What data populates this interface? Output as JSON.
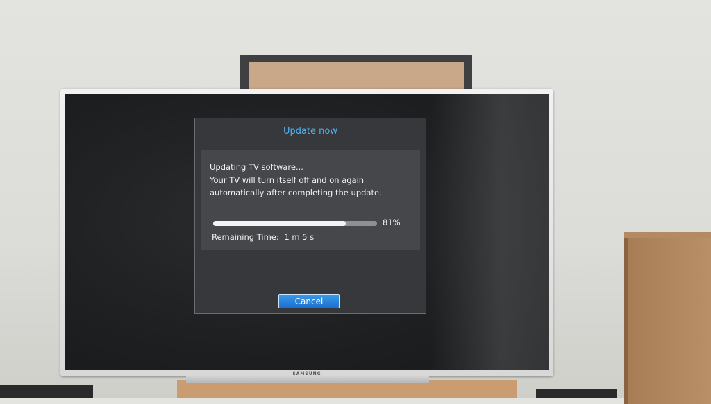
{
  "dialog": {
    "title": "Update now",
    "message_lines": [
      "Updating TV software...",
      "Your TV will turn itself off and on again",
      "automatically after completing the update."
    ],
    "progress_percent": 81,
    "progress_label": "81%",
    "remaining_label": "Remaining Time:",
    "remaining_value": "1 m  5 s",
    "cancel_label": "Cancel"
  },
  "tv": {
    "brand": "SAMSUNG"
  },
  "colors": {
    "title_accent": "#4fb3f0",
    "button_blue": "#2a86dc",
    "dialog_bg": "#38393d"
  }
}
